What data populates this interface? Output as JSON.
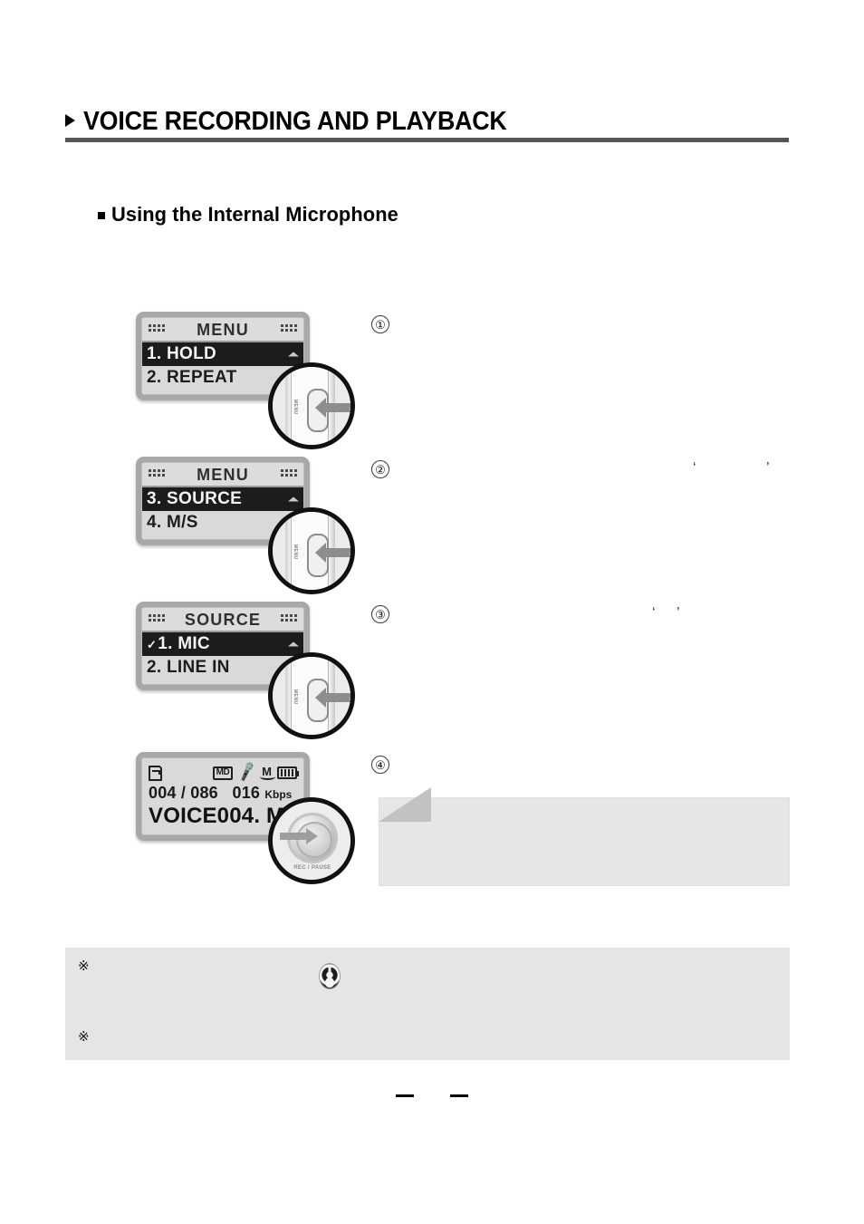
{
  "page": {
    "header": {
      "marker_icon": "triangle-right-icon",
      "title": "VOICE RECORDING AND PLAYBACK"
    },
    "section": {
      "marker_icon": "square-bullet-icon",
      "subtitle": "Using the Internal Microphone"
    },
    "steps": [
      {
        "number": "①",
        "instruction": "",
        "quote_open": "",
        "quote_close": "",
        "callout_icon": "side-button-magnifier-icon",
        "screen": {
          "type": "menu",
          "title": "MENU",
          "left_dots_icon": "dot-grid-icon",
          "right_dots_icon": "dot-grid-icon",
          "items": [
            {
              "label": "1. HOLD",
              "selected": true,
              "checked": false
            },
            {
              "label": "2. REPEAT",
              "selected": false,
              "checked": false
            }
          ],
          "scroll_arrow_icon": "scroll-up-arrow-icon"
        }
      },
      {
        "number": "②",
        "instruction": "",
        "quote_open": "‘",
        "quote_close": "’",
        "callout_icon": "side-button-magnifier-icon",
        "screen": {
          "type": "menu",
          "title": "MENU",
          "left_dots_icon": "dot-grid-icon",
          "right_dots_icon": "dot-grid-icon",
          "items": [
            {
              "label": "3. SOURCE",
              "selected": true,
              "checked": false
            },
            {
              "label": "4. M/S",
              "selected": false,
              "checked": false
            }
          ],
          "scroll_arrow_icon": "scroll-up-arrow-icon"
        }
      },
      {
        "number": "③",
        "instruction": "",
        "quote_open": "‘",
        "quote_close": "’",
        "callout_icon": "side-button-magnifier-icon",
        "screen": {
          "type": "menu",
          "title": "SOURCE",
          "left_dots_icon": "dot-grid-icon",
          "right_dots_icon": "dot-grid-icon",
          "items": [
            {
              "label": "1. MIC",
              "selected": true,
              "checked": true,
              "check_glyph": "✓"
            },
            {
              "label": "2. LINE IN",
              "selected": false,
              "checked": false
            }
          ],
          "scroll_arrow_icon": "scroll-up-arrow-icon"
        }
      },
      {
        "number": "④",
        "instruction": "",
        "quote_open": "",
        "quote_close": "",
        "callout_icon": "rec-pause-button-magnifier-icon",
        "rec_button_label": "REC / PAUSE",
        "screen": {
          "type": "status",
          "icons": [
            "file-icon",
            "md-badge-icon",
            "microphone-icon",
            "mono-icon",
            "battery-icon"
          ],
          "md_badge_text": "MD",
          "mono_text": "M",
          "track_counter": "004 / 086",
          "bitrate_value": "016",
          "bitrate_unit": "Kbps",
          "file_name": "VOICE004. M"
        }
      }
    ],
    "tip_callout": {
      "flag_icon": "corner-flag-icon",
      "text": ""
    },
    "notes": {
      "mark": "※",
      "jog_icon": "jog-dial-icon",
      "items": [
        {
          "mark": "※",
          "text": ""
        },
        {
          "mark": "※",
          "text": ""
        }
      ]
    },
    "footer": {
      "dash_left": "",
      "page_number": "",
      "dash_right": ""
    }
  }
}
